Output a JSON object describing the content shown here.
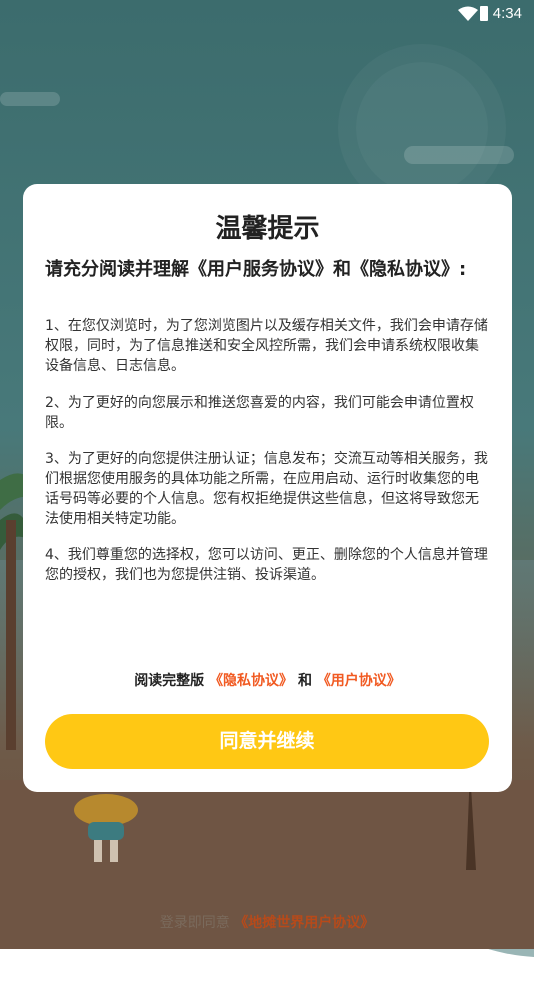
{
  "status_bar": {
    "time": "4:34"
  },
  "dialog": {
    "title": "温馨提示",
    "subtitle": "请充分阅读并理解《用户服务协议》和《隐私协议》:",
    "paragraphs": [
      "1、在您仅浏览时，为了您浏览图片以及缓存相关文件，我们会申请存储权限，同时，为了信息推送和安全风控所需，我们会申请系统权限收集设备信息、日志信息。",
      " 2、为了更好的向您展示和推送您喜爱的内容，我们可能会申请位置权限。",
      " 3、为了更好的向您提供注册认证；信息发布；交流互动等相关服务，我们根据您使用服务的具体功能之所需，在应用启动、运行时收集您的电话号码等必要的个人信息。您有权拒绝提供这些信息，但这将导致您无法使用相关特定功能。",
      " 4、我们尊重您的选择权，您可以访问、更正、删除您的个人信息并管理您的授权，我们也为您提供注销、投诉渠道。"
    ],
    "read_full": {
      "prefix": "阅读完整版",
      "privacy_link": "《隐私协议》",
      "and": "和",
      "user_link": "《用户协议》"
    },
    "agree_button": "同意并继续"
  },
  "footer": {
    "prefix": "登录即同意",
    "link": "《地摊世界用户协议》"
  },
  "colors": {
    "accent_button": "#ffc814",
    "link": "#f15a22",
    "overlay_bg": "#3c6c6d"
  }
}
